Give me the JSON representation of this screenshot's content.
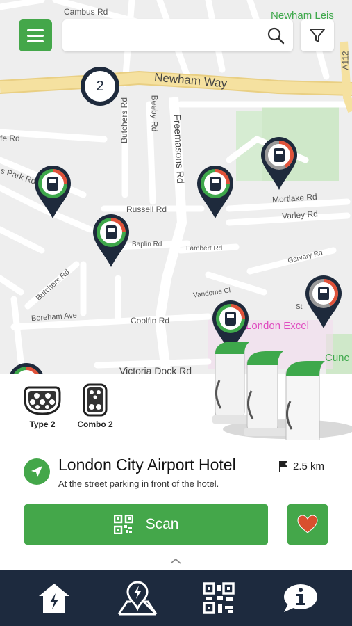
{
  "map": {
    "streets": {
      "cambus": "Cambus Rd",
      "newham_leisure": "Newham Leis",
      "newham_way": "Newham Way",
      "a112": "A112",
      "butchers_top": "Butchers Rd",
      "beeby": "Beeby Rd",
      "freemasons": "Freemasons Rd",
      "fe": "fe Rd",
      "park": "s Park Rd",
      "russell": "Russell Rd",
      "mortlake": "Mortlake Rd",
      "varley": "Varley Rd",
      "baplin": "Baplin Rd",
      "lambert": "Lambert Rd",
      "garvary": "Garvary Rd",
      "vandome": "Vandome Cl",
      "butchers_bottom": "Butchers Rd",
      "boreham": "Boreham Ave",
      "coolfin": "Coolfin Rd",
      "victoria": "Victoria Dock Rd",
      "excel": "London Excel",
      "cunc": "Cunc",
      "st": "St"
    },
    "cluster_count": "2",
    "colors": {
      "pin": "#1e2a3c",
      "ring_green": "#3ea84b",
      "ring_red": "#e0523a",
      "park": "#cfe8c9"
    }
  },
  "search": {
    "placeholder": ""
  },
  "connectors": [
    {
      "label": "Type 2",
      "icon": "type2-connector-icon"
    },
    {
      "label": "Combo 2",
      "icon": "combo2-connector-icon"
    }
  ],
  "station": {
    "name": "London City Airport Hotel",
    "description": "At the street parking in front of the hotel.",
    "distance": "2.5 km"
  },
  "actions": {
    "scan_label": "Scan"
  },
  "nav": [
    {
      "icon": "home-charger-icon"
    },
    {
      "icon": "map-charger-icon"
    },
    {
      "icon": "qr-code-icon"
    },
    {
      "icon": "info-bubble-icon"
    }
  ],
  "colors": {
    "accent": "#44a74a",
    "nav_bg": "#1d2a3e",
    "heart": "#d9502e"
  }
}
